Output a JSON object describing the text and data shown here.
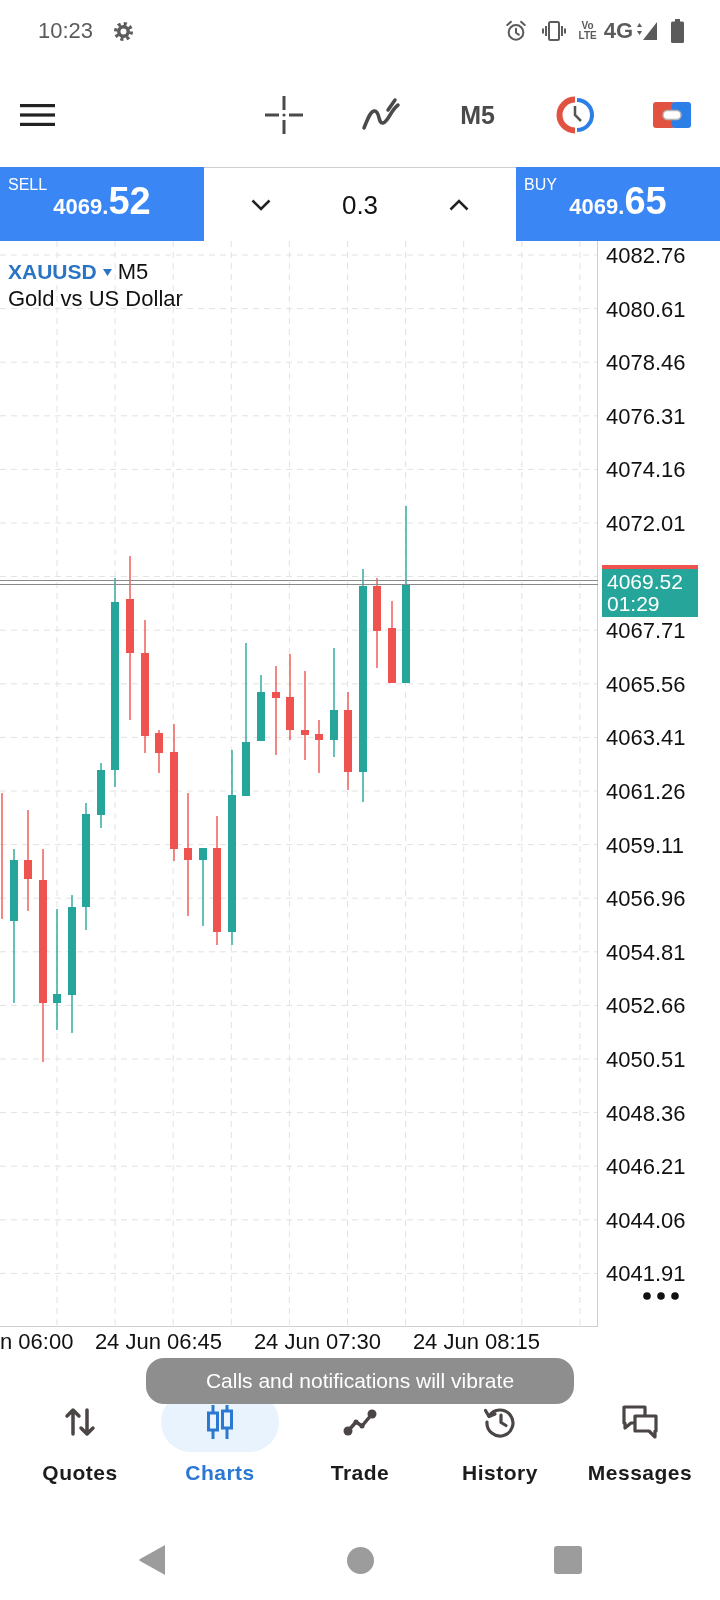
{
  "status_bar": {
    "time": "10:23",
    "volte": "Vo LTE",
    "network": "4G"
  },
  "toolbar": {
    "timeframe": "M5"
  },
  "trade_panel": {
    "sell": {
      "label": "SELL",
      "price": "4069.**52**"
    },
    "volume": "0.3",
    "buy": {
      "label": "BUY",
      "price": "4069.**65**"
    }
  },
  "chart": {
    "symbol": "XAUUSD",
    "timeframe": "M5",
    "description": "Gold vs US Dollar",
    "price_axis": [
      "4082.76",
      "4080.61",
      "4078.46",
      "4076.31",
      "4074.16",
      "4072.01",
      "4067.71",
      "4065.56",
      "4063.41",
      "4061.26",
      "4059.11",
      "4056.96",
      "4054.81",
      "4052.66",
      "4050.51",
      "4048.36",
      "4046.21",
      "4044.06",
      "4041.91"
    ],
    "current_price": {
      "price": "4069.52",
      "countdown": "01:29"
    },
    "time_axis": [
      "n 06:00",
      "24 Jun 06:45",
      "24 Jun 07:30",
      "24 Jun 08:15"
    ]
  },
  "toast": {
    "text": "Calls and notifications will vibrate"
  },
  "bottom_nav": [
    {
      "label": "Quotes",
      "selected": false
    },
    {
      "label": "Charts",
      "selected": true
    },
    {
      "label": "Trade",
      "selected": false
    },
    {
      "label": "History",
      "selected": false
    },
    {
      "label": "Messages",
      "selected": false
    }
  ]
}
